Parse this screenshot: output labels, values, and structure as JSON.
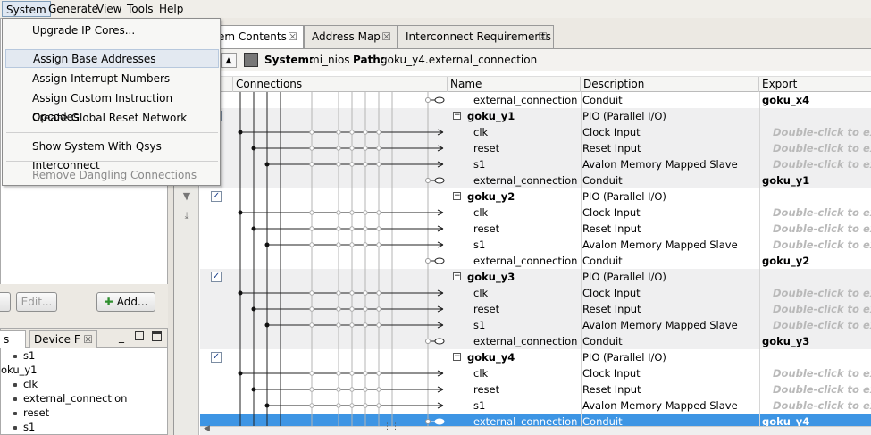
{
  "menubar": {
    "items": [
      "System",
      "Generate",
      "View",
      "Tools",
      "Help"
    ]
  },
  "system_menu": {
    "items": [
      {
        "label": "Upgrade IP Cores...",
        "enabled": true
      },
      {
        "label": "Assign Base Addresses",
        "enabled": true,
        "highlighted": true
      },
      {
        "label": "Assign Interrupt Numbers",
        "enabled": true
      },
      {
        "label": "Assign Custom Instruction Opcodes",
        "enabled": true
      },
      {
        "label": "Create Global Reset Network",
        "enabled": true
      },
      {
        "label": "Show System With Qsys Interconnect",
        "enabled": true
      },
      {
        "label": "Remove Dangling Connections",
        "enabled": false
      }
    ]
  },
  "left_panel": {
    "edit_button": "Edit...",
    "add_button": "Add...",
    "tabs": [
      "s",
      "Device F"
    ],
    "tree": [
      {
        "label": "s1",
        "indent": 1
      },
      {
        "label": "oku_y1",
        "indent": 0
      },
      {
        "label": "clk",
        "indent": 1
      },
      {
        "label": "external_connection",
        "indent": 1
      },
      {
        "label": "reset",
        "indent": 1
      },
      {
        "label": "s1",
        "indent": 1
      }
    ]
  },
  "main": {
    "tabs": [
      {
        "label": "em Contents",
        "active": true
      },
      {
        "label": "Address Map",
        "active": false
      },
      {
        "label": "Interconnect Requirements",
        "active": false
      }
    ],
    "path_bar": {
      "system_label": "System:",
      "system_value": "mi_nios",
      "path_label": "Path:",
      "path_value": "goku_y4.external_connection"
    },
    "columns": [
      "Connections",
      "Name",
      "Description",
      "Export"
    ],
    "rows": [
      {
        "type": "iface",
        "name": "external_connection",
        "desc": "Conduit",
        "export": "goku_x4",
        "export_bold": true,
        "conduit": true
      },
      {
        "type": "comp",
        "name": "goku_y1",
        "desc": "PIO (Parallel I/O)",
        "export": ""
      },
      {
        "type": "iface",
        "name": "clk",
        "desc": "Clock Input",
        "export": "Double-click to expo"
      },
      {
        "type": "iface",
        "name": "reset",
        "desc": "Reset Input",
        "export": "Double-click to expo"
      },
      {
        "type": "iface",
        "name": "s1",
        "desc": "Avalon Memory Mapped Slave",
        "export": "Double-click to expo"
      },
      {
        "type": "iface",
        "name": "external_connection",
        "desc": "Conduit",
        "export": "goku_y1",
        "export_bold": true,
        "conduit": true
      },
      {
        "type": "comp",
        "name": "goku_y2",
        "desc": "PIO (Parallel I/O)",
        "export": "",
        "checked": true
      },
      {
        "type": "iface",
        "name": "clk",
        "desc": "Clock Input",
        "export": "Double-click to expo"
      },
      {
        "type": "iface",
        "name": "reset",
        "desc": "Reset Input",
        "export": "Double-click to expo"
      },
      {
        "type": "iface",
        "name": "s1",
        "desc": "Avalon Memory Mapped Slave",
        "export": "Double-click to expo"
      },
      {
        "type": "iface",
        "name": "external_connection",
        "desc": "Conduit",
        "export": "goku_y2",
        "export_bold": true,
        "conduit": true
      },
      {
        "type": "comp",
        "name": "goku_y3",
        "desc": "PIO (Parallel I/O)",
        "export": "",
        "checked": true
      },
      {
        "type": "iface",
        "name": "clk",
        "desc": "Clock Input",
        "export": "Double-click to expo"
      },
      {
        "type": "iface",
        "name": "reset",
        "desc": "Reset Input",
        "export": "Double-click to expo"
      },
      {
        "type": "iface",
        "name": "s1",
        "desc": "Avalon Memory Mapped Slave",
        "export": "Double-click to expo"
      },
      {
        "type": "iface",
        "name": "external_connection",
        "desc": "Conduit",
        "export": "goku_y3",
        "export_bold": true,
        "conduit": true
      },
      {
        "type": "comp",
        "name": "goku_y4",
        "desc": "PIO (Parallel I/O)",
        "export": "",
        "checked": true
      },
      {
        "type": "iface",
        "name": "clk",
        "desc": "Clock Input",
        "export": "Double-click to expo"
      },
      {
        "type": "iface",
        "name": "reset",
        "desc": "Reset Input",
        "export": "Double-click to expo"
      },
      {
        "type": "iface",
        "name": "s1",
        "desc": "Avalon Memory Mapped Slave",
        "export": "Double-click to expo"
      },
      {
        "type": "iface",
        "name": "external_connection",
        "desc": "Conduit",
        "export": "goku_y4",
        "export_bold": true,
        "conduit": true,
        "selected": true
      }
    ]
  },
  "colors": {
    "selection": "#3d95e4",
    "shade": "#efeff0",
    "hint_text": "#b9b9b9"
  }
}
